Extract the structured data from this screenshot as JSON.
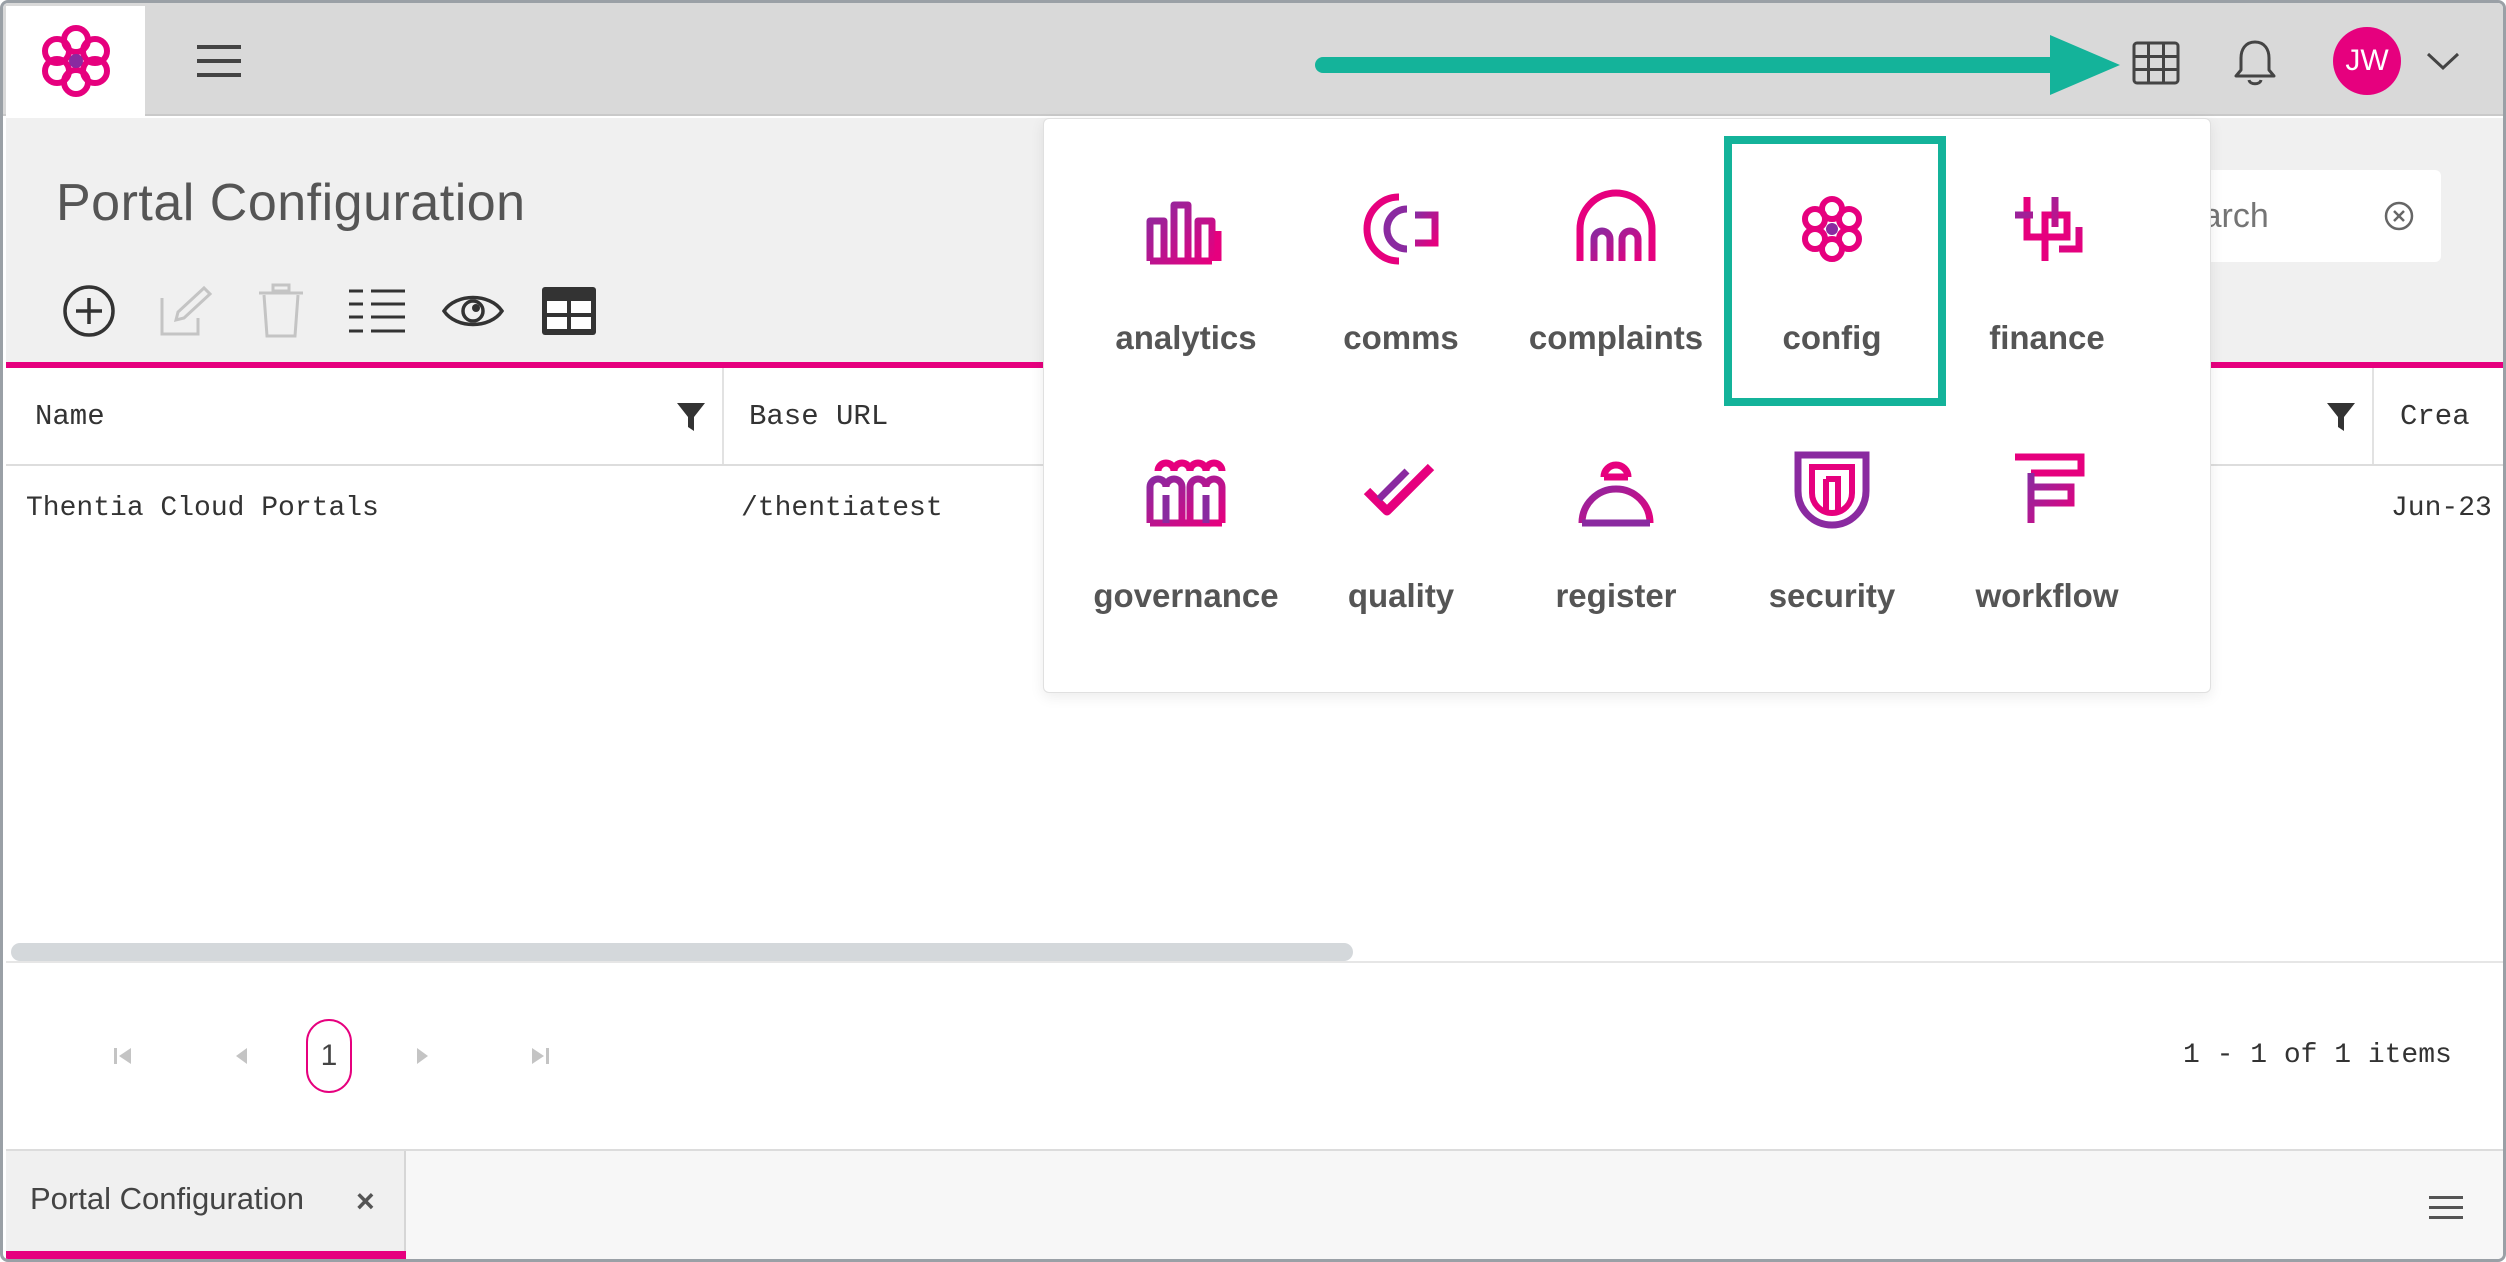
{
  "header": {
    "user_initials": "JW"
  },
  "page": {
    "title": "Portal Configuration",
    "search_placeholder": "Search"
  },
  "grid": {
    "columns": [
      "Name",
      "Base URL",
      "Crea"
    ],
    "rows": [
      {
        "name": "Thentia Cloud Portals",
        "base_url": "/thentiatest",
        "created": "Jun-23"
      }
    ]
  },
  "pager": {
    "current_page": "1",
    "summary": "1 - 1 of 1 items"
  },
  "bottom_tabs": [
    {
      "label": "Portal Configuration",
      "close": "×"
    }
  ],
  "launcher": {
    "apps": [
      {
        "label": "analytics",
        "icon": "analytics-icon"
      },
      {
        "label": "comms",
        "icon": "comms-icon"
      },
      {
        "label": "complaints",
        "icon": "complaints-icon"
      },
      {
        "label": "config",
        "icon": "config-icon"
      },
      {
        "label": "finance",
        "icon": "finance-icon"
      },
      {
        "label": "governance",
        "icon": "governance-icon"
      },
      {
        "label": "quality",
        "icon": "quality-icon"
      },
      {
        "label": "register",
        "icon": "register-icon"
      },
      {
        "label": "security",
        "icon": "security-icon"
      },
      {
        "label": "workflow",
        "icon": "workflow-icon"
      }
    ],
    "highlighted": "config"
  },
  "colors": {
    "brand": "#e6007e",
    "brand_purple": "#8a2aa0",
    "annotation": "#14b39a"
  }
}
